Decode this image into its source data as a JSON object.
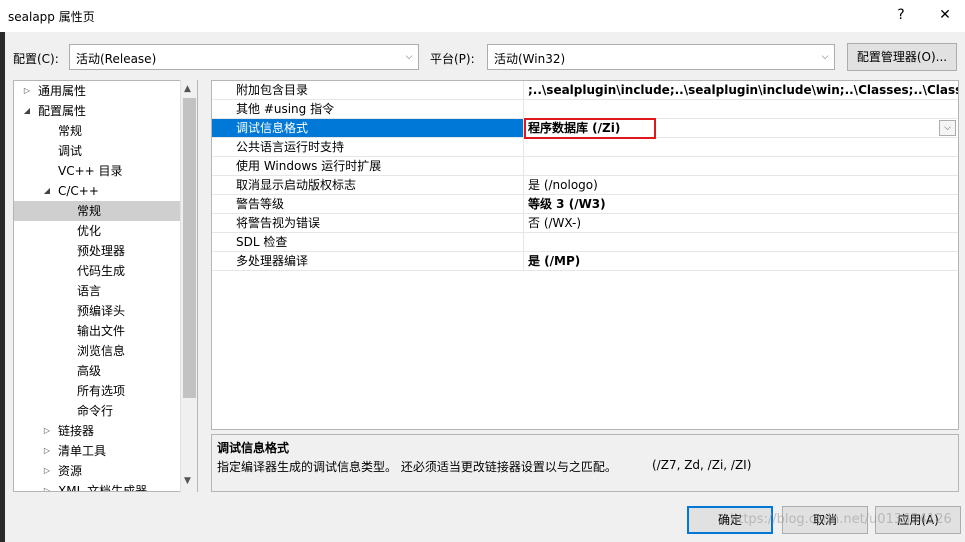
{
  "window": {
    "title": "sealapp 属性页",
    "help_glyph": "?",
    "close_glyph": "✕"
  },
  "config": {
    "label": "配置(C):",
    "value": "活动(Release)"
  },
  "platform": {
    "label": "平台(P):",
    "value": "活动(Win32)"
  },
  "config_manager_label": "配置管理器(O)...",
  "tree": [
    {
      "label": "通用属性",
      "expander": "▷"
    },
    {
      "label": "配置属性",
      "expander": "◢"
    },
    {
      "label": "常规",
      "expander": ""
    },
    {
      "label": "调试",
      "expander": ""
    },
    {
      "label": "VC++ 目录",
      "expander": ""
    },
    {
      "label": "C/C++",
      "expander": "◢"
    },
    {
      "label": "常规",
      "expander": ""
    },
    {
      "label": "优化",
      "expander": ""
    },
    {
      "label": "预处理器",
      "expander": ""
    },
    {
      "label": "代码生成",
      "expander": ""
    },
    {
      "label": "语言",
      "expander": ""
    },
    {
      "label": "预编译头",
      "expander": ""
    },
    {
      "label": "输出文件",
      "expander": ""
    },
    {
      "label": "浏览信息",
      "expander": ""
    },
    {
      "label": "高级",
      "expander": ""
    },
    {
      "label": "所有选项",
      "expander": ""
    },
    {
      "label": "命令行",
      "expander": ""
    },
    {
      "label": "链接器",
      "expander": "▷"
    },
    {
      "label": "清单工具",
      "expander": "▷"
    },
    {
      "label": "资源",
      "expander": "▷"
    },
    {
      "label": "XML 文档生成器",
      "expander": "▷"
    }
  ],
  "properties": [
    {
      "name": "附加包含目录",
      "value": ";..\\sealplugin\\include;..\\sealplugin\\include\\win;..\\Classes;..\\Classes\\Lo",
      "bold": true
    },
    {
      "name": "其他 #using 指令",
      "value": "",
      "bold": false
    },
    {
      "name": "调试信息格式",
      "value": "程序数据库 (/Zi)",
      "bold": true
    },
    {
      "name": "公共语言运行时支持",
      "value": "",
      "bold": false
    },
    {
      "name": "使用 Windows 运行时扩展",
      "value": "",
      "bold": false
    },
    {
      "name": "取消显示启动版权标志",
      "value": "是 (/nologo)",
      "bold": false
    },
    {
      "name": "警告等级",
      "value": "等级 3 (/W3)",
      "bold": true
    },
    {
      "name": "将警告视为错误",
      "value": "否 (/WX-)",
      "bold": false
    },
    {
      "name": "SDL 检查",
      "value": "",
      "bold": false
    },
    {
      "name": "多处理器编译",
      "value": "是 (/MP)",
      "bold": true
    }
  ],
  "description": {
    "title": "调试信息格式",
    "text": "指定编译器生成的调试信息类型。 还必须适当更改链接器设置以与之匹配。",
    "options": "(/Z7, Zd, /Zi, /ZI)"
  },
  "buttons": {
    "ok": "确定",
    "cancel": "取消",
    "apply": "应用(A)"
  },
  "watermark": "https://blog.csdn.net/u013654126",
  "colors": {
    "selection": "#0078d7",
    "highlight_border": "#e0181b",
    "ok_border": "#0078d7"
  }
}
